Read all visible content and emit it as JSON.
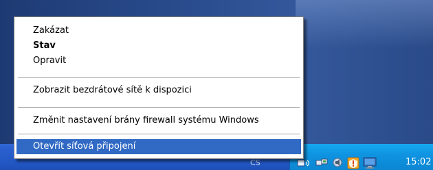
{
  "context_menu": {
    "items": [
      {
        "label": "Zakázat"
      },
      {
        "label": "Stav"
      },
      {
        "label": "Opravit"
      },
      {
        "label": "Zobrazit bezdrátové sítě k dispozici"
      },
      {
        "label": "Změnit nastavení brány firewall systému Windows"
      },
      {
        "label": "Otevřít síťová připojení"
      }
    ]
  },
  "taskbar": {
    "language": "CS",
    "tray_icons": [
      "wireless-network-icon",
      "network-connection-icon",
      "volume-icon",
      "security-center-warning-icon",
      "monitor-icon"
    ],
    "clock": "15:02"
  },
  "colors": {
    "selection": "#316ac5",
    "taskbar": "#245ac7",
    "tray": "#0f94e1"
  }
}
